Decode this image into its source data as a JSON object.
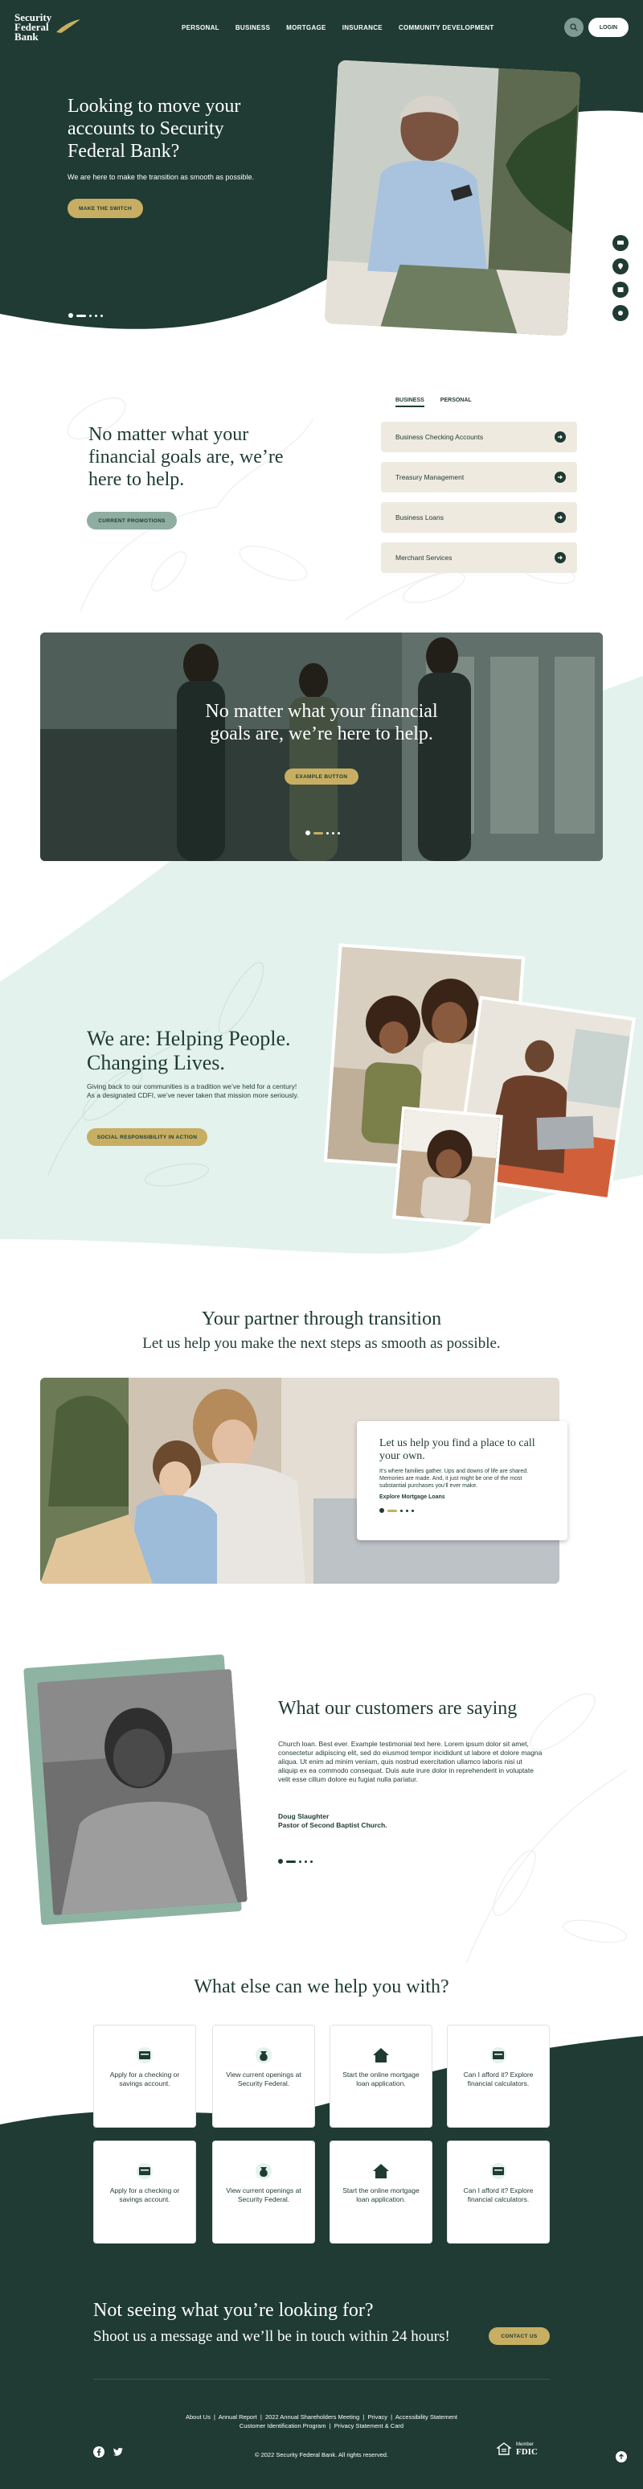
{
  "brand": {
    "name_line1": "Security",
    "name_line2": "Federal",
    "name_line3": "Bank",
    "colors": {
      "dark_green": "#1f3b33",
      "gold": "#c7ae62",
      "sage": "#8fada1",
      "mint": "#e3f2ec",
      "cream": "#efeae0"
    }
  },
  "nav": {
    "items": [
      "PERSONAL",
      "BUSINESS",
      "MORTGAGE",
      "INSURANCE",
      "COMMUNITY DEVELOPMENT"
    ],
    "search_icon": "search-icon",
    "login_label": "LOGIN"
  },
  "hero": {
    "title": "Looking to move your accounts to Security Federal Bank?",
    "subtitle": "We are here to make the transition as smooth as possible.",
    "cta": "MAKE THE SWITCH"
  },
  "side_icons": [
    "chat-icon",
    "location-icon",
    "calendar-icon",
    "phone-icon"
  ],
  "goals": {
    "title": "No matter what your financial goals are, we’re here to help.",
    "cta": "CURRENT PROMOTIONS",
    "tabs": [
      "BUSINESS",
      "PERSONAL"
    ],
    "active_tab": "BUSINESS",
    "items": [
      "Business Checking Accounts",
      "Treasury Management",
      "Business Loans",
      "Merchant Services"
    ]
  },
  "banner": {
    "title": "No matter what your financial goals are, we’re here to help.",
    "cta": "EXAMPLE BUTTON"
  },
  "about": {
    "title": "We are: Helping People. Changing Lives.",
    "body": "Giving back to our communities is a tradition we’ve held for a century! As a designated CDFI, we’ve never taken that mission more seriously.",
    "cta": "SOCIAL RESPONSIBILITY IN ACTION"
  },
  "transition": {
    "title": "Your partner through transition",
    "subtitle": "Let us help you make the next steps as smooth as possible.",
    "card_title": "Let us help you find a place to call your own.",
    "card_body": "It’s where families gather. Ups and downs of life are shared. Memories are made. And, it just might be one of the most substantial purchases you’ll ever make.",
    "card_link": "Explore Mortgage Loans"
  },
  "testimonial": {
    "title": "What our customers are saying",
    "body": "Church loan. Best ever. Example testimonial text here. Lorem ipsum dolor sit amet, consectetur adipiscing elit, sed do eiusmod tempor incididunt ut labore et dolore magna aliqua. Ut enim ad minim veniam, quis nostrud exercitation ullamco laboris nisi ut aliquip ex ea commodo consequat. Duis aute irure dolor in reprehenderit in voluptate velit esse cillum dolore eu fugiat nulla pariatur.",
    "name": "Doug Slaughter",
    "role": "Pastor of Second Baptist Church."
  },
  "help": {
    "title": "What else can we help you with?",
    "cards": [
      {
        "icon": "wallet-icon",
        "label": "Apply for a checking or savings account."
      },
      {
        "icon": "money-bag-icon",
        "label": "View current openings at Security Federal."
      },
      {
        "icon": "house-icon",
        "label": "Start the online mortgage loan application."
      },
      {
        "icon": "wallet-icon",
        "label": "Can I afford it? Explore financial calculators."
      },
      {
        "icon": "wallet-icon",
        "label": "Apply for a checking or savings account."
      },
      {
        "icon": "money-bag-icon",
        "label": "View current openings at Security Federal."
      },
      {
        "icon": "house-icon",
        "label": "Start the online mortgage loan application."
      },
      {
        "icon": "wallet-icon",
        "label": "Can I afford it? Explore financial calculators."
      }
    ]
  },
  "footer": {
    "title": "Not seeing what you’re looking for?",
    "subtitle": "Shoot us a message and we’ll be in touch within 24 hours!",
    "cta": "CONTACT US",
    "links_row1": [
      "About Us",
      "Annual Report",
      "2022 Annual Shareholders Meeting",
      "Privacy",
      "Accessibility Statement"
    ],
    "links_row2": [
      "Customer Identification Program",
      "Privacy Statement & Card"
    ],
    "copyright": "© 2022 Security Federal Bank. All rights reserved.",
    "member_label": "Member",
    "fdic_label": "FDIC"
  }
}
